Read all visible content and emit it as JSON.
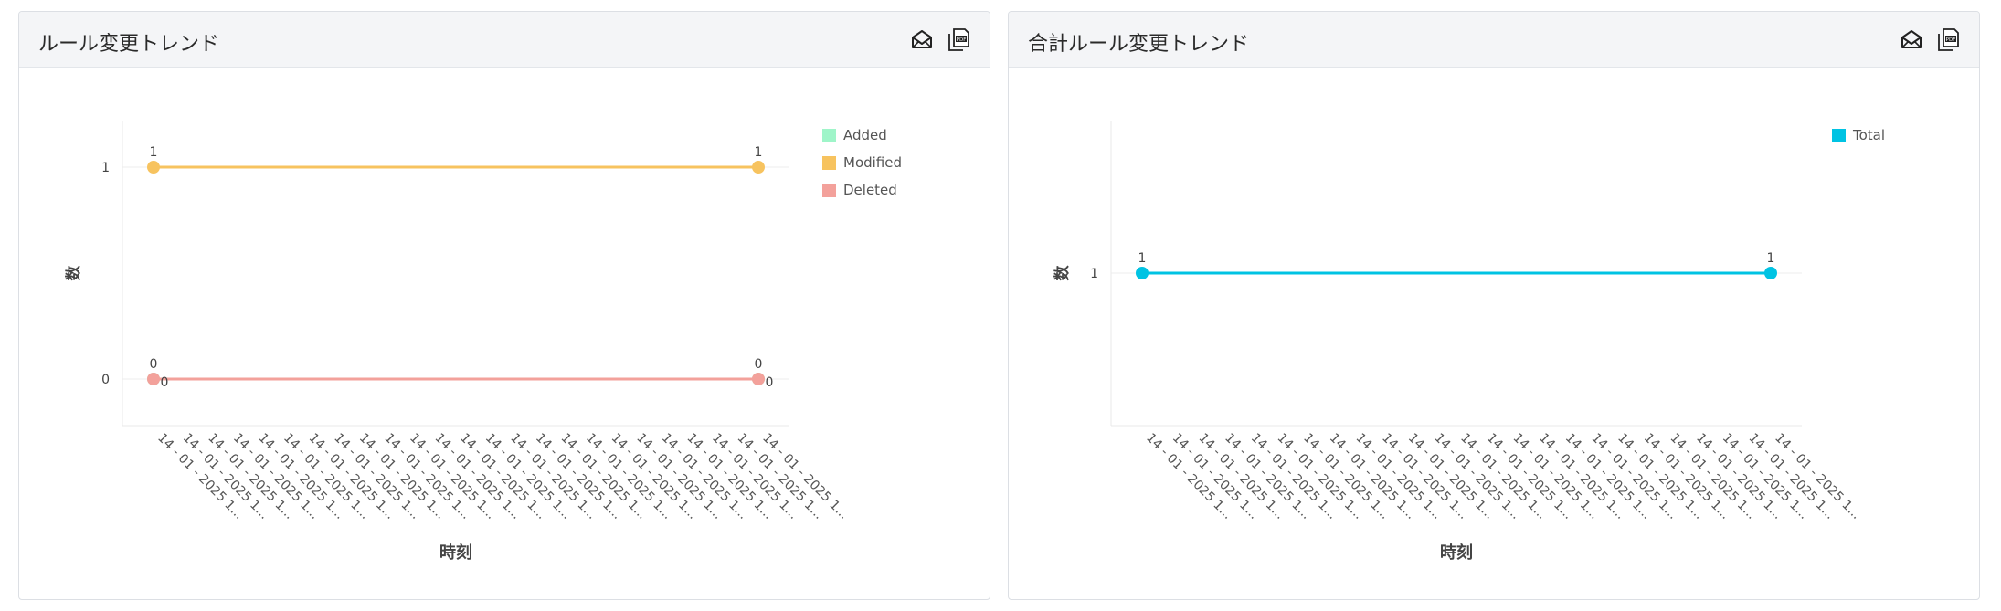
{
  "panels": {
    "left": {
      "title": "ルール変更トレンド"
    },
    "right": {
      "title": "合計ルール変更トレンド"
    }
  },
  "icons": {
    "email": "email-icon",
    "pdf": "pdf-export-icon"
  },
  "chart_data": [
    {
      "type": "line",
      "ylabel": "数",
      "xlabel": "時刻",
      "yticks": [
        0,
        1
      ],
      "ylim": [
        -0.22,
        1.22
      ],
      "grid": true,
      "legend_position": "top-right",
      "x": [
        "14 - 01 - 2025 1...",
        "14 - 01 - 2025 1...",
        "14 - 01 - 2025 1...",
        "14 - 01 - 2025 1...",
        "14 - 01 - 2025 1...",
        "14 - 01 - 2025 1...",
        "14 - 01 - 2025 1...",
        "14 - 01 - 2025 1...",
        "14 - 01 - 2025 1...",
        "14 - 01 - 2025 1...",
        "14 - 01 - 2025 1...",
        "14 - 01 - 2025 1...",
        "14 - 01 - 2025 1...",
        "14 - 01 - 2025 1...",
        "14 - 01 - 2025 1...",
        "14 - 01 - 2025 1...",
        "14 - 01 - 2025 1...",
        "14 - 01 - 2025 1...",
        "14 - 01 - 2025 1...",
        "14 - 01 - 2025 1...",
        "14 - 01 - 2025 1...",
        "14 - 01 - 2025 1...",
        "14 - 01 - 2025 1...",
        "14 - 01 - 2025 1...",
        "14 - 01 - 2025 1..."
      ],
      "series": [
        {
          "name": "Added",
          "color": "#9ff5c9",
          "values": [
            0,
            0,
            0,
            0,
            0,
            0,
            0,
            0,
            0,
            0,
            0,
            0,
            0,
            0,
            0,
            0,
            0,
            0,
            0,
            0,
            0,
            0,
            0,
            0,
            0
          ]
        },
        {
          "name": "Modified",
          "color": "#f7c35f",
          "values": [
            1,
            1,
            1,
            1,
            1,
            1,
            1,
            1,
            1,
            1,
            1,
            1,
            1,
            1,
            1,
            1,
            1,
            1,
            1,
            1,
            1,
            1,
            1,
            1,
            1
          ]
        },
        {
          "name": "Deleted",
          "color": "#f3a19b",
          "values": [
            0,
            0,
            0,
            0,
            0,
            0,
            0,
            0,
            0,
            0,
            0,
            0,
            0,
            0,
            0,
            0,
            0,
            0,
            0,
            0,
            0,
            0,
            0,
            0,
            0
          ]
        }
      ]
    },
    {
      "type": "line",
      "ylabel": "数",
      "xlabel": "時刻",
      "yticks": [
        1
      ],
      "ylim": [
        0,
        2
      ],
      "grid": true,
      "legend_position": "top-right",
      "x": [
        "14 - 01 - 2025 1...",
        "14 - 01 - 2025 1...",
        "14 - 01 - 2025 1...",
        "14 - 01 - 2025 1...",
        "14 - 01 - 2025 1...",
        "14 - 01 - 2025 1...",
        "14 - 01 - 2025 1...",
        "14 - 01 - 2025 1...",
        "14 - 01 - 2025 1...",
        "14 - 01 - 2025 1...",
        "14 - 01 - 2025 1...",
        "14 - 01 - 2025 1...",
        "14 - 01 - 2025 1...",
        "14 - 01 - 2025 1...",
        "14 - 01 - 2025 1...",
        "14 - 01 - 2025 1...",
        "14 - 01 - 2025 1...",
        "14 - 01 - 2025 1...",
        "14 - 01 - 2025 1...",
        "14 - 01 - 2025 1...",
        "14 - 01 - 2025 1...",
        "14 - 01 - 2025 1...",
        "14 - 01 - 2025 1...",
        "14 - 01 - 2025 1...",
        "14 - 01 - 2025 1..."
      ],
      "series": [
        {
          "name": "Total",
          "color": "#00c3e3",
          "values": [
            1,
            1,
            1,
            1,
            1,
            1,
            1,
            1,
            1,
            1,
            1,
            1,
            1,
            1,
            1,
            1,
            1,
            1,
            1,
            1,
            1,
            1,
            1,
            1,
            1
          ]
        }
      ]
    }
  ]
}
